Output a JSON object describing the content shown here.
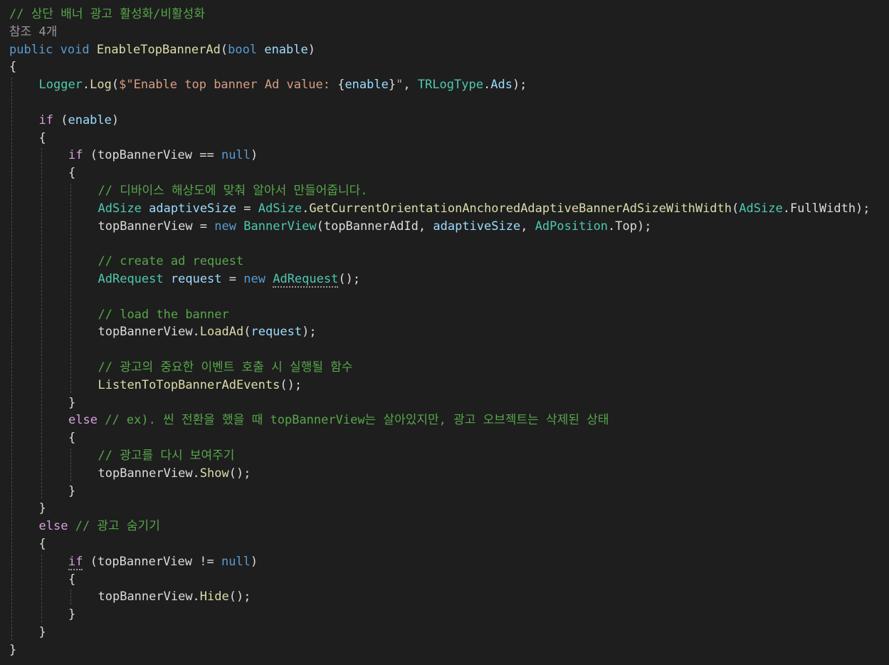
{
  "colors": {
    "background": "#1e1e1e",
    "plain": "#dcdcdc",
    "comment": "#57a64a",
    "keyword": "#569cd6",
    "control": "#d8a0df",
    "type": "#4ec9b0",
    "method": "#dcdcaa",
    "identifier": "#9cdcfe",
    "string": "#d69d85",
    "codelens": "#999999"
  },
  "code_lines": [
    {
      "indent": 0,
      "tokens": [
        {
          "t": "cm",
          "text": "// 상단 배너 광고 활성화/비활성화"
        }
      ]
    },
    {
      "indent": 0,
      "tokens": [
        {
          "t": "ref",
          "text": "참조 4개"
        }
      ]
    },
    {
      "indent": 0,
      "tokens": [
        {
          "t": "kw",
          "text": "public"
        },
        {
          "t": "pl",
          "text": " "
        },
        {
          "t": "kw",
          "text": "void"
        },
        {
          "t": "pl",
          "text": " "
        },
        {
          "t": "fn",
          "text": "EnableTopBannerAd"
        },
        {
          "t": "pl",
          "text": "("
        },
        {
          "t": "kw",
          "text": "bool"
        },
        {
          "t": "pl",
          "text": " "
        },
        {
          "t": "id",
          "text": "enable"
        },
        {
          "t": "pl",
          "text": ")"
        }
      ]
    },
    {
      "indent": 0,
      "tokens": [
        {
          "t": "pl",
          "text": "{"
        }
      ]
    },
    {
      "indent": 1,
      "tokens": [
        {
          "t": "type",
          "text": "Logger"
        },
        {
          "t": "pl",
          "text": "."
        },
        {
          "t": "fn",
          "text": "Log"
        },
        {
          "t": "pl",
          "text": "("
        },
        {
          "t": "str",
          "text": "$\"Enable top banner Ad value: "
        },
        {
          "t": "pl",
          "text": "{"
        },
        {
          "t": "id",
          "text": "enable"
        },
        {
          "t": "pl",
          "text": "}"
        },
        {
          "t": "str",
          "text": "\""
        },
        {
          "t": "pl",
          "text": ", "
        },
        {
          "t": "type",
          "text": "TRLogType"
        },
        {
          "t": "pl",
          "text": "."
        },
        {
          "t": "id",
          "text": "Ads"
        },
        {
          "t": "pl",
          "text": ");"
        }
      ]
    },
    {
      "indent": 1,
      "tokens": []
    },
    {
      "indent": 1,
      "tokens": [
        {
          "t": "ctl",
          "text": "if"
        },
        {
          "t": "pl",
          "text": " ("
        },
        {
          "t": "id",
          "text": "enable"
        },
        {
          "t": "pl",
          "text": ")"
        }
      ]
    },
    {
      "indent": 1,
      "tokens": [
        {
          "t": "pl",
          "text": "{"
        }
      ]
    },
    {
      "indent": 2,
      "tokens": [
        {
          "t": "ctl",
          "text": "if"
        },
        {
          "t": "pl",
          "text": " ("
        },
        {
          "t": "pl",
          "text": "topBannerView"
        },
        {
          "t": "pl",
          "text": " == "
        },
        {
          "t": "kw",
          "text": "null"
        },
        {
          "t": "pl",
          "text": ")"
        }
      ]
    },
    {
      "indent": 2,
      "tokens": [
        {
          "t": "pl",
          "text": "{"
        }
      ]
    },
    {
      "indent": 3,
      "tokens": [
        {
          "t": "cm",
          "text": "// 디바이스 해상도에 맞춰 알아서 만들어줍니다."
        }
      ]
    },
    {
      "indent": 3,
      "tokens": [
        {
          "t": "type",
          "text": "AdSize"
        },
        {
          "t": "pl",
          "text": " "
        },
        {
          "t": "id",
          "text": "adaptiveSize"
        },
        {
          "t": "pl",
          "text": " = "
        },
        {
          "t": "type",
          "text": "AdSize"
        },
        {
          "t": "pl",
          "text": "."
        },
        {
          "t": "fn",
          "text": "GetCurrentOrientationAnchoredAdaptiveBannerAdSizeWithWidth"
        },
        {
          "t": "pl",
          "text": "("
        },
        {
          "t": "type",
          "text": "AdSize"
        },
        {
          "t": "pl",
          "text": "."
        },
        {
          "t": "pl",
          "text": "FullWidth);"
        }
      ]
    },
    {
      "indent": 3,
      "tokens": [
        {
          "t": "pl",
          "text": "topBannerView"
        },
        {
          "t": "pl",
          "text": " = "
        },
        {
          "t": "kw",
          "text": "new"
        },
        {
          "t": "pl",
          "text": " "
        },
        {
          "t": "type",
          "text": "BannerView"
        },
        {
          "t": "pl",
          "text": "(topBannerAdId, "
        },
        {
          "t": "id",
          "text": "adaptiveSize"
        },
        {
          "t": "pl",
          "text": ", "
        },
        {
          "t": "type",
          "text": "AdPosition"
        },
        {
          "t": "pl",
          "text": ".Top);"
        }
      ]
    },
    {
      "indent": 3,
      "tokens": []
    },
    {
      "indent": 3,
      "tokens": [
        {
          "t": "cm",
          "text": "// create ad request"
        }
      ]
    },
    {
      "indent": 3,
      "tokens": [
        {
          "t": "type",
          "text": "AdRequest"
        },
        {
          "t": "pl",
          "text": " "
        },
        {
          "t": "id",
          "text": "request"
        },
        {
          "t": "pl",
          "text": " = "
        },
        {
          "t": "kw",
          "text": "new"
        },
        {
          "t": "pl",
          "text": " "
        },
        {
          "t": "type",
          "text": "AdRequest",
          "squiggle": true
        },
        {
          "t": "pl",
          "text": "();"
        }
      ]
    },
    {
      "indent": 3,
      "tokens": []
    },
    {
      "indent": 3,
      "tokens": [
        {
          "t": "cm",
          "text": "// load the banner"
        }
      ]
    },
    {
      "indent": 3,
      "tokens": [
        {
          "t": "pl",
          "text": "topBannerView."
        },
        {
          "t": "fn",
          "text": "LoadAd"
        },
        {
          "t": "pl",
          "text": "("
        },
        {
          "t": "id",
          "text": "request"
        },
        {
          "t": "pl",
          "text": ");"
        }
      ]
    },
    {
      "indent": 3,
      "tokens": []
    },
    {
      "indent": 3,
      "tokens": [
        {
          "t": "cm",
          "text": "// 광고의 중요한 이벤트 호출 시 실행될 함수"
        }
      ]
    },
    {
      "indent": 3,
      "tokens": [
        {
          "t": "fn",
          "text": "ListenToTopBannerAdEvents"
        },
        {
          "t": "pl",
          "text": "();"
        }
      ]
    },
    {
      "indent": 2,
      "tokens": [
        {
          "t": "pl",
          "text": "}"
        }
      ]
    },
    {
      "indent": 2,
      "tokens": [
        {
          "t": "ctl",
          "text": "else"
        },
        {
          "t": "pl",
          "text": " "
        },
        {
          "t": "cm",
          "text": "// ex). 씬 전환을 했을 때 topBannerView는 살아있지만, 광고 오브젝트는 삭제된 상태"
        }
      ]
    },
    {
      "indent": 2,
      "tokens": [
        {
          "t": "pl",
          "text": "{"
        }
      ]
    },
    {
      "indent": 3,
      "tokens": [
        {
          "t": "cm",
          "text": "// 광고를 다시 보여주기"
        }
      ]
    },
    {
      "indent": 3,
      "tokens": [
        {
          "t": "pl",
          "text": "topBannerView."
        },
        {
          "t": "fn",
          "text": "Show"
        },
        {
          "t": "pl",
          "text": "();"
        }
      ]
    },
    {
      "indent": 2,
      "tokens": [
        {
          "t": "pl",
          "text": "}"
        }
      ]
    },
    {
      "indent": 1,
      "tokens": [
        {
          "t": "pl",
          "text": "}"
        }
      ]
    },
    {
      "indent": 1,
      "tokens": [
        {
          "t": "ctl",
          "text": "else"
        },
        {
          "t": "pl",
          "text": " "
        },
        {
          "t": "cm",
          "text": "// 광고 숨기기"
        }
      ]
    },
    {
      "indent": 1,
      "tokens": [
        {
          "t": "pl",
          "text": "{"
        }
      ]
    },
    {
      "indent": 2,
      "tokens": [
        {
          "t": "ctl",
          "text": "if",
          "squiggle": true
        },
        {
          "t": "pl",
          "text": " (topBannerView != "
        },
        {
          "t": "kw",
          "text": "null"
        },
        {
          "t": "pl",
          "text": ")"
        }
      ]
    },
    {
      "indent": 2,
      "tokens": [
        {
          "t": "pl",
          "text": "{"
        }
      ]
    },
    {
      "indent": 3,
      "tokens": [
        {
          "t": "pl",
          "text": "topBannerView."
        },
        {
          "t": "fn",
          "text": "Hide"
        },
        {
          "t": "pl",
          "text": "();"
        }
      ]
    },
    {
      "indent": 2,
      "tokens": [
        {
          "t": "pl",
          "text": "}"
        }
      ]
    },
    {
      "indent": 1,
      "tokens": [
        {
          "t": "pl",
          "text": "}"
        }
      ]
    },
    {
      "indent": 0,
      "tokens": [
        {
          "t": "pl",
          "text": "}"
        }
      ]
    }
  ]
}
